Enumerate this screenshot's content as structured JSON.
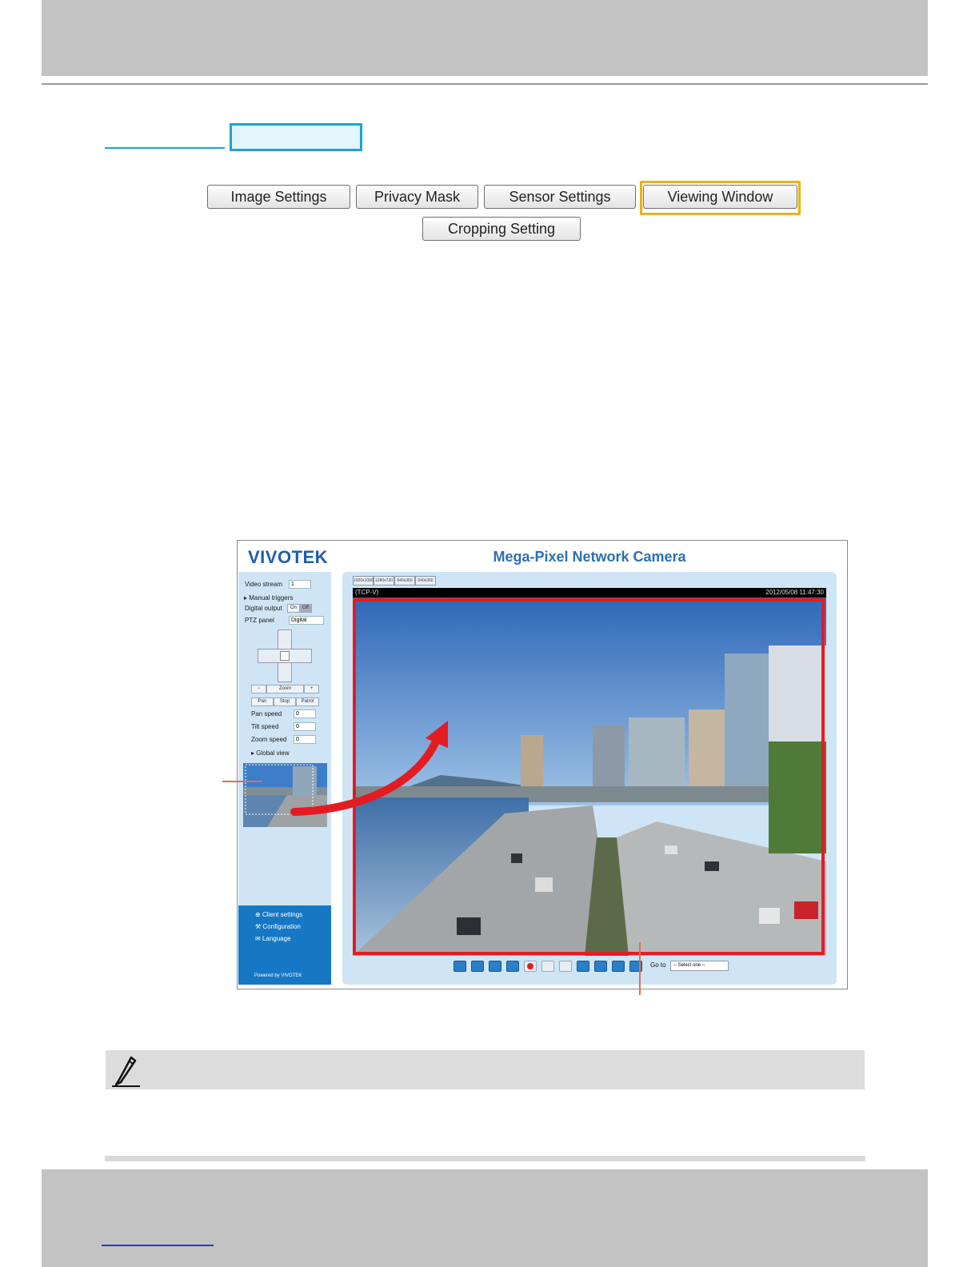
{
  "settings_buttons": {
    "image_settings": "Image Settings",
    "privacy_mask": "Privacy Mask",
    "sensor_settings": "Sensor Settings",
    "viewing_window": "Viewing Window",
    "cropping_setting": "Cropping Setting"
  },
  "camera_page": {
    "logo": "VIVOTEK",
    "title": "Mega-Pixel Network Camera",
    "left_panel": {
      "video_stream_label": "Video stream",
      "video_stream_value": "1",
      "manual_triggers": "Manual triggers",
      "digital_output": "Digital output",
      "on": "On",
      "off": "Off",
      "ptz_panel_label": "PTZ panel",
      "ptz_panel_value": "Digital",
      "zoom_label": "Zoom",
      "pan_button": "Pan",
      "stop_button": "Stop",
      "patrol_button": "Patrol",
      "pan_speed_label": "Pan speed",
      "tilt_speed_label": "Tilt speed",
      "zoom_speed_label": "Zoom speed",
      "speed_value": "0",
      "global_view": "Global view",
      "client_settings": "Client settings",
      "configuration": "Configuration",
      "language": "Language",
      "powered_by": "Powered by VIVOTEK"
    },
    "stream_tabs": [
      "1920x1080",
      "1280x720",
      "640x360",
      "640x360"
    ],
    "video_protocol": "(TCP-V)",
    "video_timestamp": "2012/05/08 11:47:30",
    "goto_label": "Go to",
    "goto_select": "-- Select one --"
  }
}
